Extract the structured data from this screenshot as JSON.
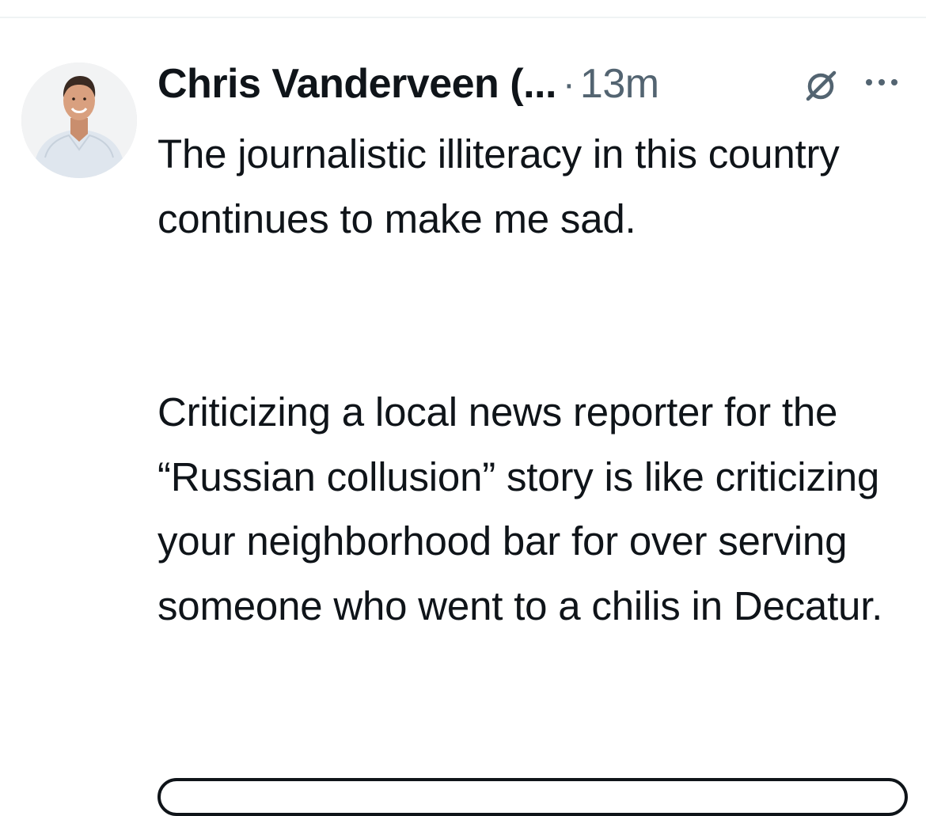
{
  "tweet": {
    "author_name": "Chris Vanderveen (...",
    "separator": "·",
    "time": "13m",
    "paragraphs": [
      "The journalistic illiteracy in this country continues to make me sad.",
      "Criticizing a local news reporter for the “Russian collusion” story is like criticizing your neighborhood bar for over serving someone who went to a chilis in Decatur."
    ]
  },
  "icons": {
    "avatar": "profile-photo",
    "grok": "grok-icon",
    "more": "more-options-icon"
  },
  "colors": {
    "text_primary": "#0f1419",
    "text_secondary": "#536471",
    "divider": "#eff3f4",
    "background": "#ffffff"
  }
}
